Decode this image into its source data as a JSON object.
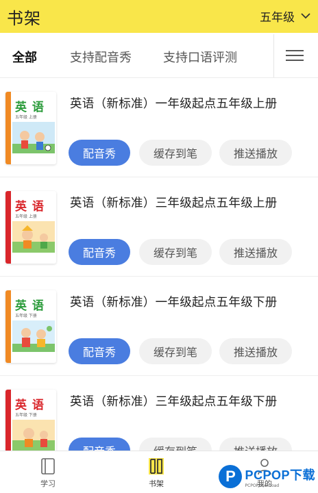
{
  "header": {
    "title": "书架",
    "grade": "五年级",
    "background_color": "#f9e64a"
  },
  "tabs": [
    {
      "label": "全部",
      "active": true
    },
    {
      "label": "支持配音秀",
      "active": false
    },
    {
      "label": "支持口语评测",
      "active": false
    }
  ],
  "menu_icon": "hamburger-menu-icon",
  "books": [
    {
      "title": "英语（新标准）一年级起点五年级上册",
      "cover_title": "英 语",
      "cover_sub": "五年级 上册",
      "cover_spine_color": "#f08a24",
      "dub_label": "配音秀",
      "cache_label": "缓存到笔",
      "push_label": "推送播放"
    },
    {
      "title": "英语（新标准）三年级起点五年级上册",
      "cover_title": "英 语",
      "cover_sub": "五年级 上册",
      "cover_spine_color": "#d9262b",
      "dub_label": "配音秀",
      "cache_label": "缓存到笔",
      "push_label": "推送播放"
    },
    {
      "title": "英语（新标准）一年级起点五年级下册",
      "cover_title": "英 语",
      "cover_sub": "五年级 下册",
      "cover_spine_color": "#f08a24",
      "dub_label": "配音秀",
      "cache_label": "缓存到笔",
      "push_label": "推送播放"
    },
    {
      "title": "英语（新标准）三年级起点五年级下册",
      "cover_title": "英 语",
      "cover_sub": "五年级 下册",
      "cover_spine_color": "#d9262b",
      "dub_label": "配音秀",
      "cache_label": "缓存到笔",
      "push_label": "推送播放"
    }
  ],
  "primary_button_color": "#4a7de0",
  "bottom_nav": [
    {
      "label": "学习",
      "icon": "book-icon",
      "active": false
    },
    {
      "label": "书架",
      "icon": "bookshelf-icon",
      "active": true
    },
    {
      "label": "我的",
      "icon": "person-icon",
      "active": false
    }
  ],
  "watermark": {
    "logo_letter": "P",
    "main": "PCPOP下载",
    "small": "PCPOP.download"
  }
}
